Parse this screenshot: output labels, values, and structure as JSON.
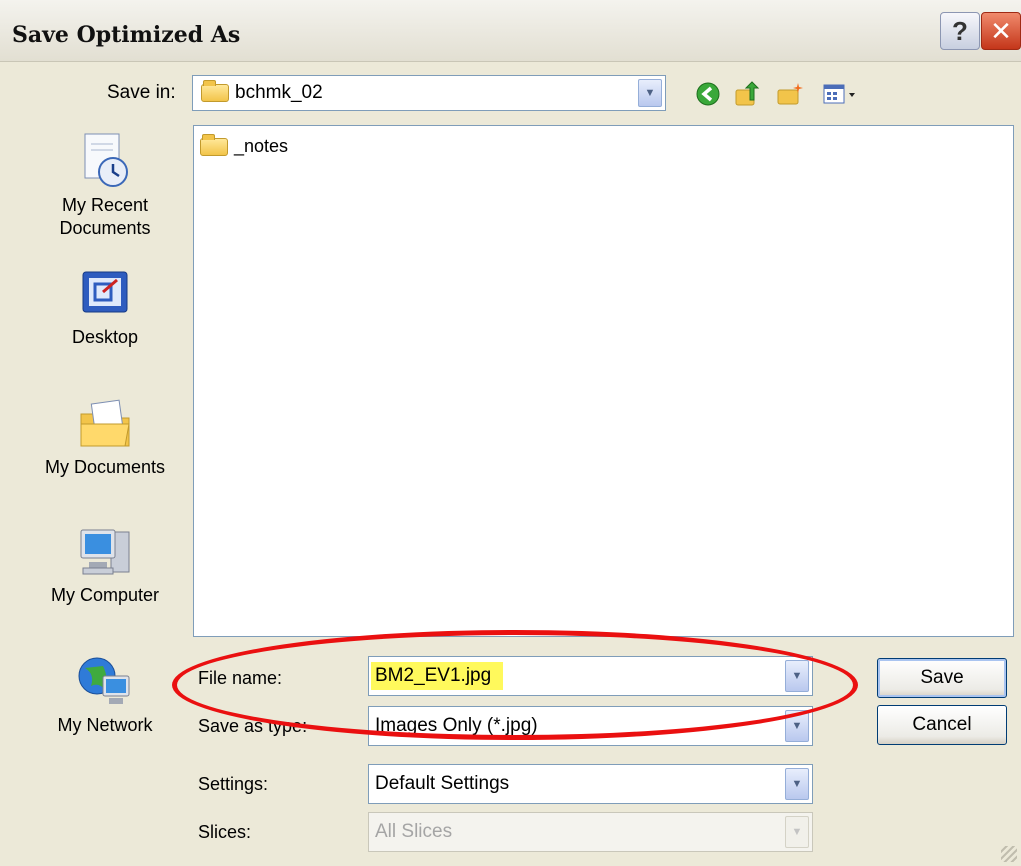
{
  "window": {
    "title": "Save Optimized As",
    "help_label": "?",
    "close_label": "✕"
  },
  "toolbar": {
    "save_in_label": "Save in:",
    "save_in_value": "bchmk_02",
    "back_icon": "back-icon",
    "up_icon": "up-folder-icon",
    "new_folder_icon": "new-folder-icon",
    "views_icon": "views-menu-icon"
  },
  "places": [
    {
      "label": "My Recent\nDocuments",
      "icon": "recent-documents-icon"
    },
    {
      "label": "Desktop",
      "icon": "desktop-icon"
    },
    {
      "label": "My Documents",
      "icon": "my-documents-icon"
    },
    {
      "label": "My Computer",
      "icon": "my-computer-icon"
    },
    {
      "label": "My Network",
      "icon": "my-network-icon"
    }
  ],
  "files": [
    {
      "name": "_notes",
      "type": "folder"
    }
  ],
  "form": {
    "file_name_label": "File name:",
    "file_name_value": "BM2_EV1.jpg",
    "save_as_type_label": "Save as type:",
    "save_as_type_value": "Images Only (*.jpg)",
    "settings_label": "Settings:",
    "settings_value": "Default Settings",
    "slices_label": "Slices:",
    "slices_value": "All Slices"
  },
  "buttons": {
    "save": "Save",
    "cancel": "Cancel"
  },
  "colors": {
    "annotation": "#ea1010",
    "highlight": "#fff95c"
  }
}
